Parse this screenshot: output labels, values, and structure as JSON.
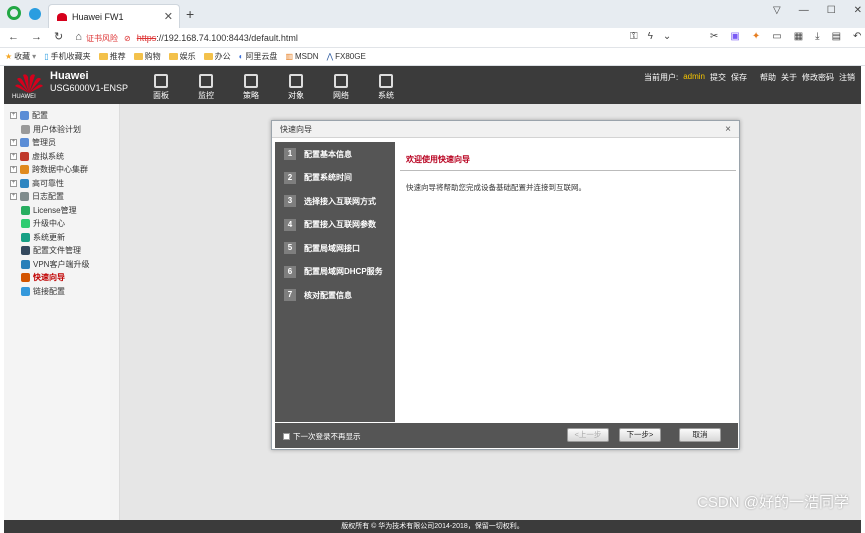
{
  "browser": {
    "tab_title": "Huawei FW1",
    "new_tab": "+",
    "security_label": "证书风险",
    "url_https": "https",
    "url_rest": "://192.168.74.100:8443/default.html",
    "window_controls": [
      "—",
      "☐",
      "✕"
    ]
  },
  "bookmarks": [
    {
      "label": "收藏",
      "icon": "star-icon"
    },
    {
      "label": "手机收藏夹",
      "icon": "phone-icon"
    },
    {
      "label": "推荐",
      "icon": "folder-icon"
    },
    {
      "label": "购物",
      "icon": "folder-icon"
    },
    {
      "label": "娱乐",
      "icon": "folder-icon"
    },
    {
      "label": "办公",
      "icon": "folder-icon"
    },
    {
      "label": "阿里云盘",
      "icon": "cloud-icon"
    },
    {
      "label": "MSDN",
      "icon": "msdn-icon"
    },
    {
      "label": "FX80GE",
      "icon": "fx-icon"
    }
  ],
  "header": {
    "brand_name": "Huawei",
    "model": "USG6000V1-ENSP",
    "nav": [
      "面板",
      "监控",
      "策略",
      "对象",
      "网络",
      "系统"
    ],
    "current_user_label": "当前用户:",
    "current_user": "admin",
    "actions": [
      "提交",
      "保存",
      "帮助",
      "关于",
      "修改密码",
      "注销"
    ]
  },
  "sidebar": {
    "items": [
      {
        "label": "配置",
        "expand": "+",
        "color": "#5b8dd6"
      },
      {
        "label": "用户体验计划",
        "expand": "",
        "color": "#9a9a9a"
      },
      {
        "label": "管理员",
        "expand": "+",
        "color": "#5b8dd6"
      },
      {
        "label": "虚拟系统",
        "expand": "+",
        "color": "#c0392b"
      },
      {
        "label": "跨数据中心集群",
        "expand": "+",
        "color": "#e08a1e"
      },
      {
        "label": "高可靠性",
        "expand": "+",
        "color": "#2e86c1"
      },
      {
        "label": "日志配置",
        "expand": "+",
        "color": "#7f8c8d"
      },
      {
        "label": "License管理",
        "expand": "",
        "color": "#27ae60"
      },
      {
        "label": "升级中心",
        "expand": "",
        "color": "#2ecc71"
      },
      {
        "label": "系统更新",
        "expand": "",
        "color": "#16a085"
      },
      {
        "label": "配置文件管理",
        "expand": "",
        "color": "#34495e"
      },
      {
        "label": "VPN客户端升级",
        "expand": "",
        "color": "#2980b9"
      },
      {
        "label": "快速向导",
        "expand": "",
        "color": "#d35400"
      },
      {
        "label": "链接配置",
        "expand": "",
        "color": "#3498db"
      }
    ]
  },
  "dialog": {
    "title": "快速向导",
    "close": "×",
    "steps": [
      {
        "num": "1",
        "label": "配置基本信息"
      },
      {
        "num": "2",
        "label": "配置系统时间"
      },
      {
        "num": "3",
        "label": "选择接入互联网方式"
      },
      {
        "num": "4",
        "label": "配置接入互联网参数"
      },
      {
        "num": "5",
        "label": "配置局域网接口"
      },
      {
        "num": "6",
        "label": "配置局域网DHCP服务"
      },
      {
        "num": "7",
        "label": "核对配置信息"
      }
    ],
    "welcome": "欢迎使用快速向导",
    "description": "快速向导将帮助您完成设备基础配置并连接到互联网。",
    "no_show_label": "下一次登录不再显示",
    "prev_button": "<上一步",
    "next_button": "下一步>",
    "cancel_button": "取消"
  },
  "footer": {
    "copyright": "版权所有 © 华为技术有限公司2014-2018，保留一切权利。"
  },
  "watermark": "CSDN @好的一浩同学"
}
